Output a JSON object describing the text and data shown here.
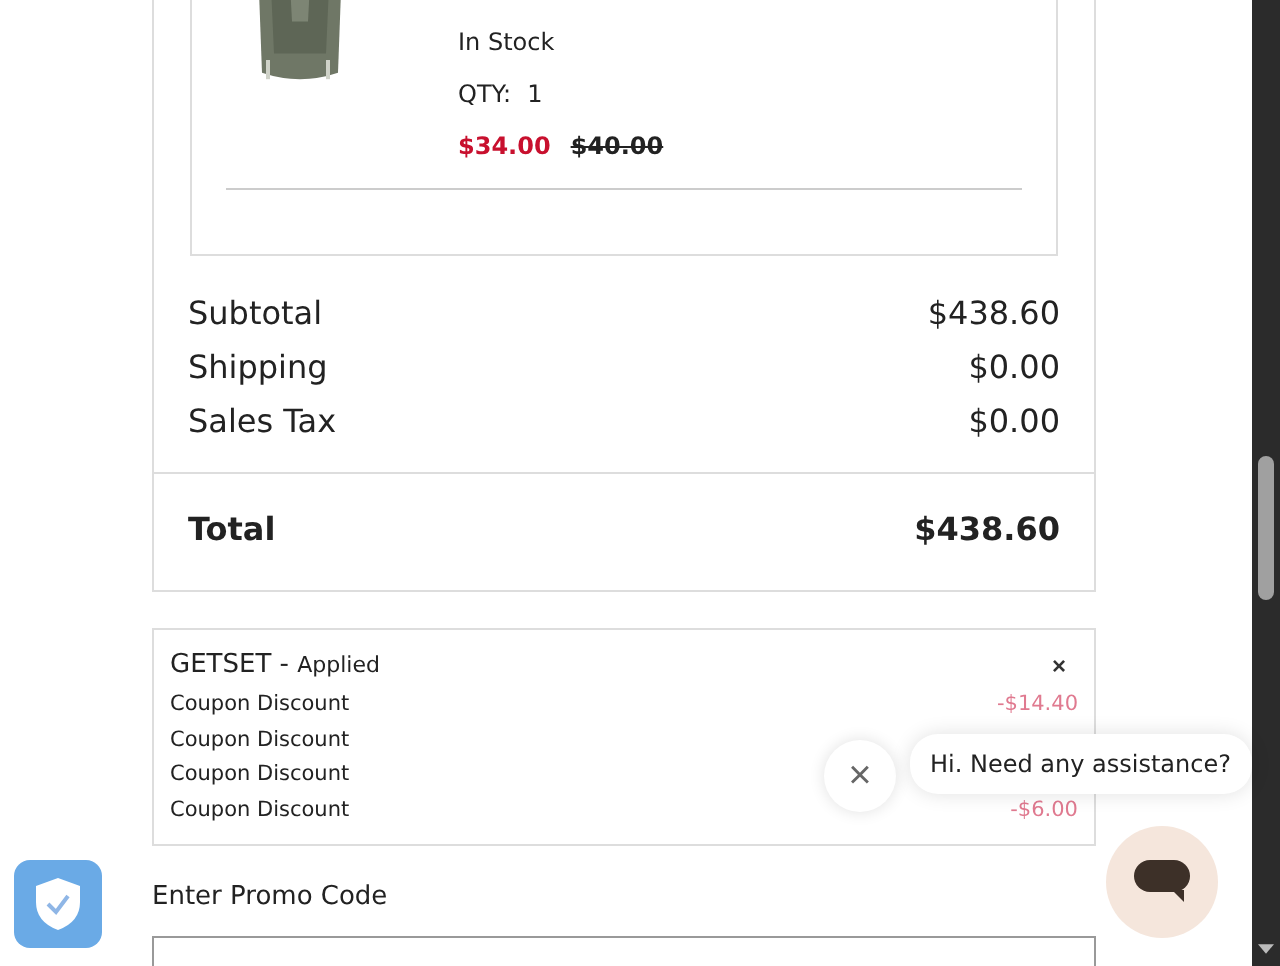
{
  "product": {
    "stock": "In Stock",
    "qty_label": "QTY:",
    "qty": "1",
    "sale_price": "$34.00",
    "original_price": "$40.00"
  },
  "summary": [
    {
      "label": "Subtotal",
      "value": "$438.60"
    },
    {
      "label": "Shipping",
      "value": "$0.00"
    },
    {
      "label": "Sales Tax",
      "value": "$0.00"
    }
  ],
  "total": {
    "label": "Total",
    "value": "$438.60"
  },
  "coupon": {
    "code": "GETSET -",
    "status": "Applied",
    "remove": "×",
    "lines": [
      {
        "label": "Coupon Discount",
        "amount": "-$14.40"
      },
      {
        "label": "Coupon Discount"
      },
      {
        "label": "Coupon Discount"
      },
      {
        "label": "Coupon Discount",
        "amount": "-$6.00"
      }
    ]
  },
  "promo": {
    "label": "Enter Promo Code"
  },
  "chat": {
    "close": "×",
    "message": "Hi. Need any assistance?"
  }
}
